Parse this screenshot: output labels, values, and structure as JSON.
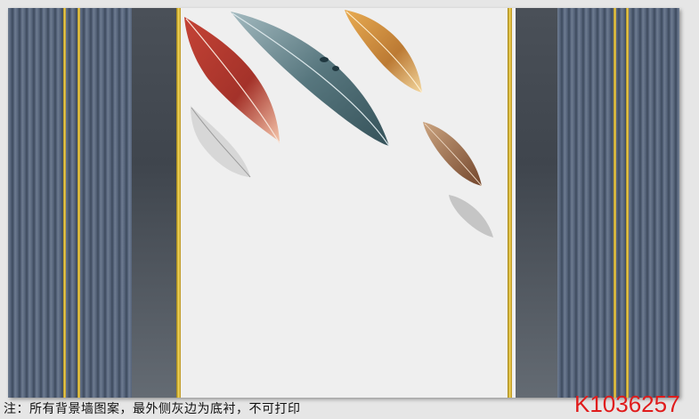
{
  "artwork": {
    "description_colors": {
      "stripe_blue": "#55637a",
      "gold": "#d9b63a",
      "center_bg": "#efefef",
      "dark_panel": "#454b53"
    }
  },
  "footer": {
    "note": "注：所有背景墙图案，最外侧灰边为底衬，不可打印",
    "code": "K1036257"
  }
}
